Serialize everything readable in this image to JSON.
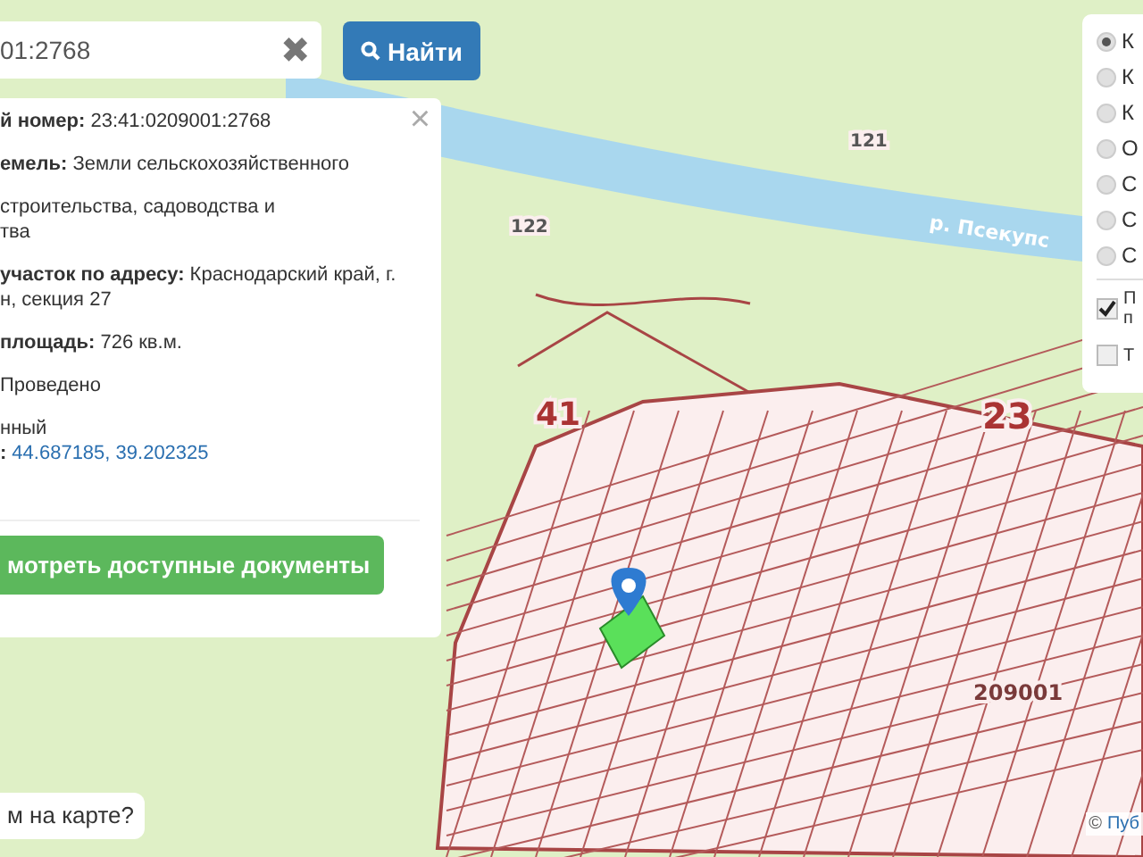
{
  "search": {
    "value": "01:2768",
    "clear": "✖",
    "button": "Найти"
  },
  "info_panel": {
    "close": "×",
    "lines": [
      {
        "kind": "field",
        "text": "**й номер:** 23:41:0209001:2768"
      },
      {
        "kind": "field",
        "text": "**емель:** Земли сельскохозяйственного"
      },
      {
        "kind": "field",
        "text": "строительства, садоводства и"
      },
      {
        "kind": "continuation",
        "text": "тва"
      },
      {
        "kind": "field",
        "text": "**участок по адресу:** Краснодарский край, г."
      },
      {
        "kind": "continuation",
        "text": "н, секция 27"
      },
      {
        "kind": "field",
        "text": "**площадь:** 726 кв.м."
      },
      {
        "kind": "field",
        "text": "Проведено"
      },
      {
        "kind": "field",
        "text": "нный"
      },
      {
        "kind": "continuation",
        "text": "**:**",
        "link": "44.687185, 39.202325"
      }
    ],
    "button": "мотреть доступные документы"
  },
  "layers": {
    "radios": [
      {
        "label": "К",
        "selected": true
      },
      {
        "label": "К",
        "selected": false
      },
      {
        "label": "К",
        "selected": false
      },
      {
        "label": "О",
        "selected": false
      },
      {
        "label": "С",
        "selected": false
      },
      {
        "label": "С",
        "selected": false
      },
      {
        "label": "С",
        "selected": false
      }
    ],
    "checks": [
      {
        "label": "П п",
        "checked": true
      },
      {
        "label": "Т",
        "checked": false
      }
    ]
  },
  "map": {
    "labels": [
      "р. Псекупс",
      "121",
      "122",
      "41",
      "23",
      "209001"
    ]
  },
  "hint": "м на карте?",
  "attribution": {
    "symbol": "©",
    "link": "Пуб"
  }
}
